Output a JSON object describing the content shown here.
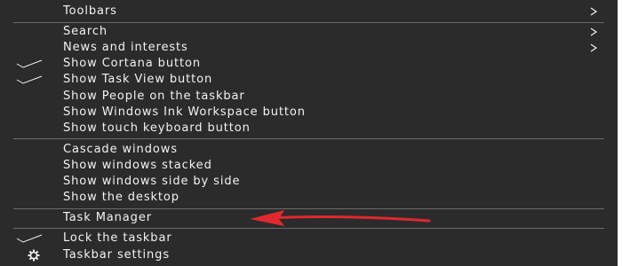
{
  "menu": {
    "items": [
      {
        "label": "Toolbars",
        "checked": false,
        "submenu": true
      },
      {
        "label": "Search",
        "checked": false,
        "submenu": true
      },
      {
        "label": "News and interests",
        "checked": false,
        "submenu": true
      },
      {
        "label": "Show Cortana button",
        "checked": true,
        "submenu": false
      },
      {
        "label": "Show Task View button",
        "checked": true,
        "submenu": false
      },
      {
        "label": "Show People on the taskbar",
        "checked": false,
        "submenu": false
      },
      {
        "label": "Show Windows Ink Workspace button",
        "checked": false,
        "submenu": false
      },
      {
        "label": "Show touch keyboard button",
        "checked": false,
        "submenu": false
      },
      {
        "label": "Cascade windows",
        "checked": false,
        "submenu": false
      },
      {
        "label": "Show windows stacked",
        "checked": false,
        "submenu": false
      },
      {
        "label": "Show windows side by side",
        "checked": false,
        "submenu": false
      },
      {
        "label": "Show the desktop",
        "checked": false,
        "submenu": false
      },
      {
        "label": "Task Manager",
        "checked": false,
        "submenu": false,
        "annotated": true
      },
      {
        "label": "Lock the taskbar",
        "checked": true,
        "submenu": false
      },
      {
        "label": "Taskbar settings",
        "checked": false,
        "submenu": false,
        "icon": "gear-icon"
      }
    ]
  },
  "colors": {
    "background": "#2b2b2b",
    "text": "#f2f2f2",
    "separator": "#6a6a6a",
    "annotation_arrow": "#e0282f"
  },
  "annotation": {
    "type": "arrow",
    "icon": "red-arrow-icon",
    "points_to": "Task Manager"
  }
}
